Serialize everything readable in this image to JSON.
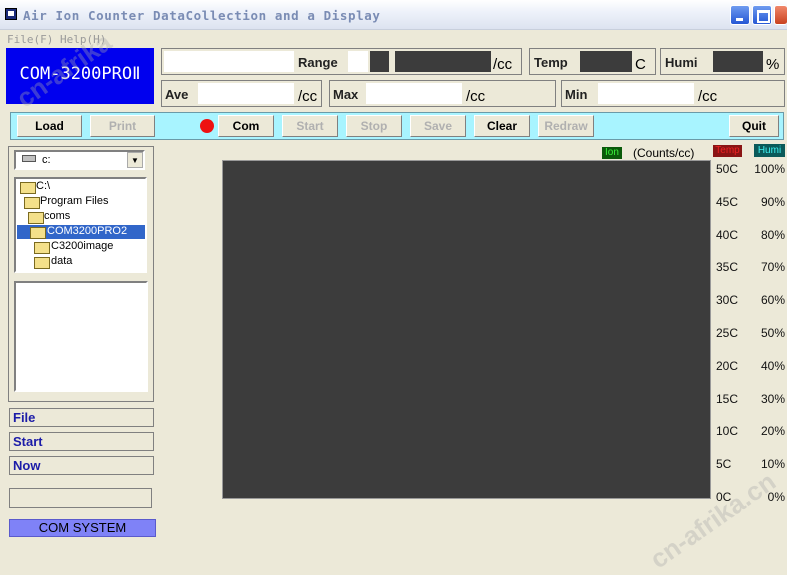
{
  "window": {
    "title": "Air Ion Counter DataCollection and a Display"
  },
  "menu": {
    "file": "File(F)",
    "help": "Help(H)"
  },
  "logo": "COM-3200PROⅡ",
  "readouts": {
    "range": {
      "label": "Range",
      "unit": "/cc"
    },
    "temp": {
      "label": "Temp",
      "unit": "C"
    },
    "humi": {
      "label": "Humi",
      "unit": "%"
    },
    "ave": {
      "label": "Ave",
      "unit": "/cc"
    },
    "max": {
      "label": "Max",
      "unit": "/cc"
    },
    "min": {
      "label": "Min",
      "unit": "/cc"
    }
  },
  "toolbar": {
    "load": "Load",
    "print": "Print",
    "com": "Com",
    "start": "Start",
    "stop": "Stop",
    "save": "Save",
    "clear": "Clear",
    "redraw": "Redraw",
    "quit": "Quit"
  },
  "drive": {
    "selected": "c:"
  },
  "folders": [
    "C:\\",
    "Program Files",
    "coms",
    "COM3200PRO2",
    "C3200image",
    "data"
  ],
  "info": {
    "file": "File",
    "start": "Start",
    "now": "Now"
  },
  "status": {
    "system": "COM SYSTEM"
  },
  "chart": {
    "legend_ion": "Ion",
    "legend_unit": "(Counts/cc)",
    "legend_temp": "Temp",
    "legend_humi": "Humi"
  },
  "chart_data": {
    "type": "line",
    "series": [],
    "y2_temp_ticks": [
      "50C",
      "45C",
      "40C",
      "35C",
      "30C",
      "25C",
      "20C",
      "15C",
      "10C",
      "5C",
      "0C"
    ],
    "y3_humi_ticks": [
      "100%",
      "90%",
      "80%",
      "70%",
      "60%",
      "50%",
      "40%",
      "30%",
      "20%",
      "10%",
      "0%"
    ],
    "grid": false,
    "colors": {
      "plot_bg": "#3c3c3c",
      "ion": "#3cf03c",
      "temp": "#ee2222",
      "humi": "#3ef0f0"
    }
  },
  "watermark": "cn-afrika.cn"
}
